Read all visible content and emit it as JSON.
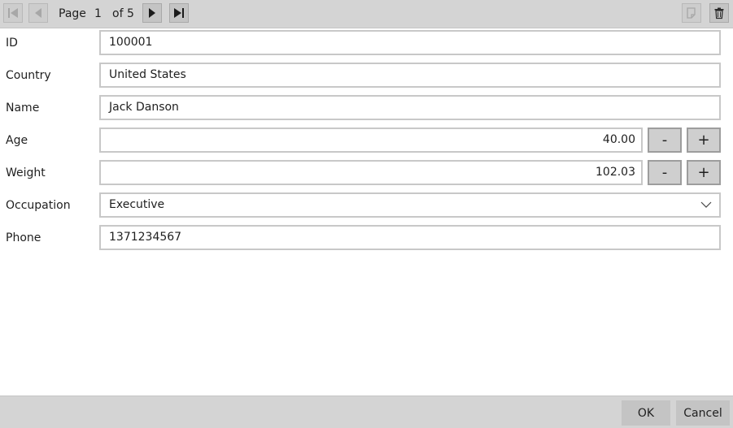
{
  "pager": {
    "page_label": "Page",
    "current_page": "1",
    "of_total": "of 5"
  },
  "form": {
    "id": {
      "label": "ID",
      "value": "100001"
    },
    "country": {
      "label": "Country",
      "value": "United States"
    },
    "name": {
      "label": "Name",
      "value": "Jack Danson"
    },
    "age": {
      "label": "Age",
      "value": "40.00",
      "decrement": "-",
      "increment": "+"
    },
    "weight": {
      "label": "Weight",
      "value": "102.03",
      "decrement": "-",
      "increment": "+"
    },
    "occupation": {
      "label": "Occupation",
      "value": "Executive"
    },
    "phone": {
      "label": "Phone",
      "value": "1371234567"
    }
  },
  "footer": {
    "ok_label": "OK",
    "cancel_label": "Cancel"
  },
  "icons": {
    "first": "first-page-icon",
    "previous": "previous-page-icon",
    "next": "next-page-icon",
    "last": "last-page-icon",
    "new": "new-record-icon",
    "delete": "trash-icon",
    "dropdown": "chevron-down-icon"
  },
  "colors": {
    "toolbar_bg": "#d4d4d4",
    "field_border": "#c8c8c8",
    "button_bg": "#cfcfcf"
  }
}
